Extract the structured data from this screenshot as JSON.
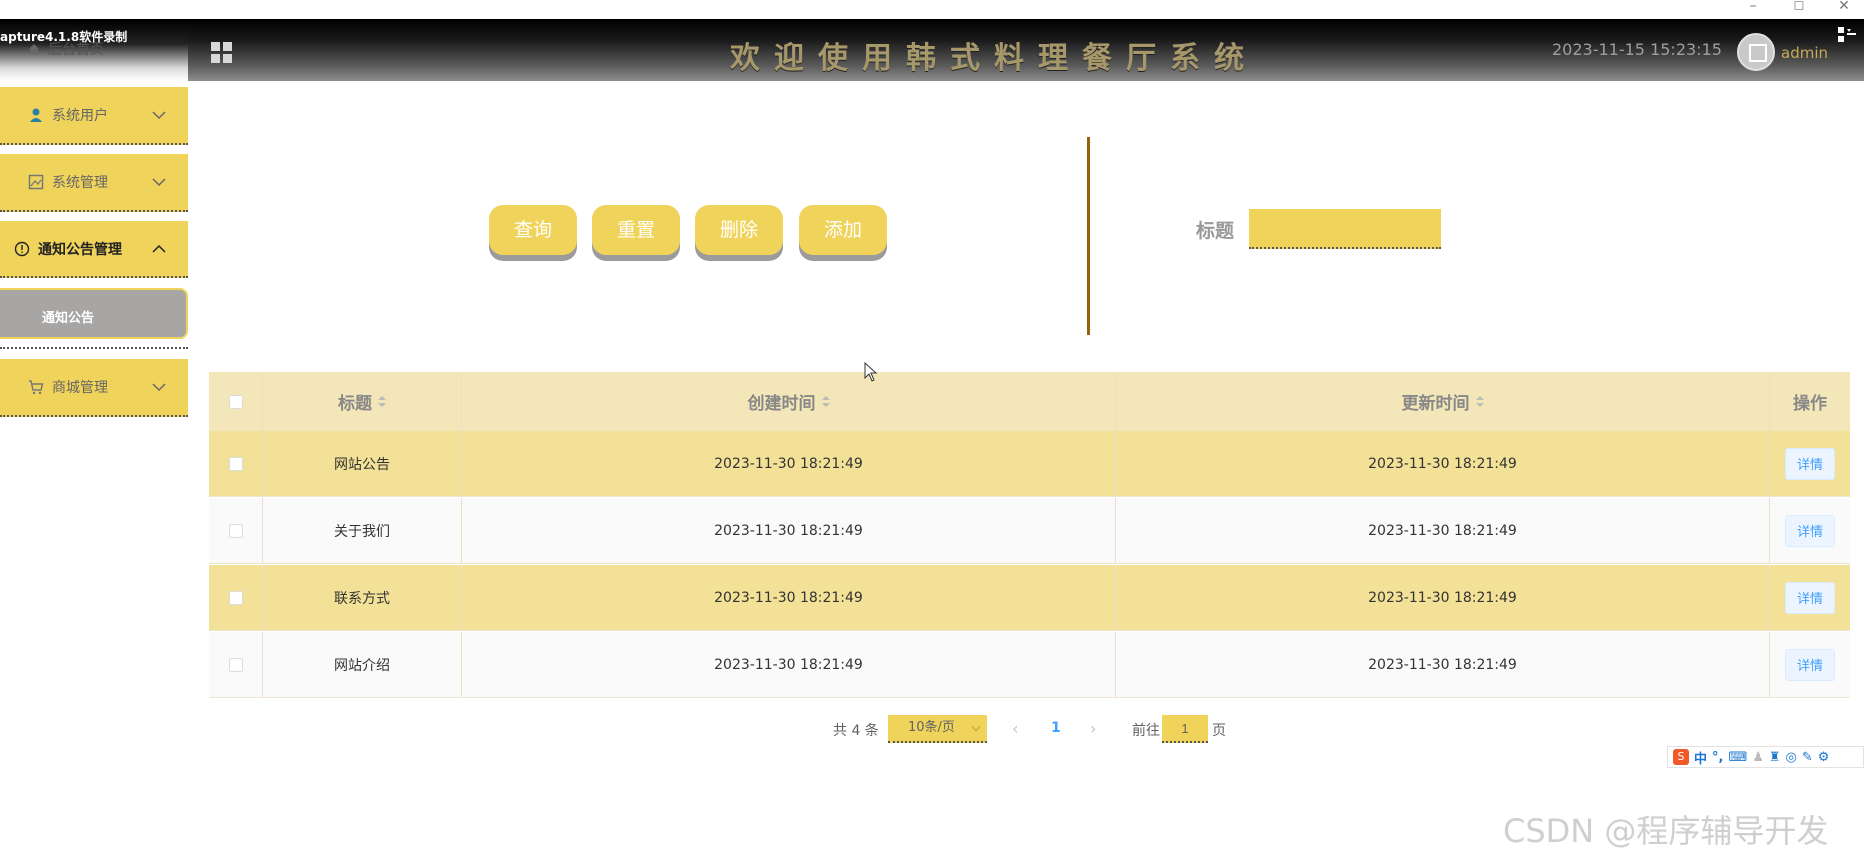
{
  "window": {
    "minimize": "–",
    "maximize": "☐",
    "close": "✕"
  },
  "header": {
    "recorder_label": "apture4.1.8软件录制",
    "home_label": "后台首页",
    "title": "欢迎使用韩式料理餐厅系统",
    "datetime": "2023-11-15 15:23:15",
    "username": "admin"
  },
  "sidebar": {
    "items": [
      {
        "label": "系统用户",
        "icon": "user-icon"
      },
      {
        "label": "系统管理",
        "icon": "image-icon"
      },
      {
        "label": "通知公告管理",
        "icon": "info-circle-icon",
        "expanded": true
      },
      {
        "label": "商城管理",
        "icon": "cart-icon"
      }
    ],
    "submenu": {
      "label": "通知公告"
    }
  },
  "toolbar": {
    "query_label": "查询",
    "reset_label": "重置",
    "delete_label": "删除",
    "add_label": "添加",
    "search_label": "标题",
    "search_value": ""
  },
  "table": {
    "columns": {
      "title": "标题",
      "created": "创建时间",
      "updated": "更新时间",
      "op": "操作"
    },
    "rows": [
      {
        "title": "网站公告",
        "created": "2023-11-30 18:21:49",
        "updated": "2023-11-30 18:21:49",
        "action": "详情"
      },
      {
        "title": "关于我们",
        "created": "2023-11-30 18:21:49",
        "updated": "2023-11-30 18:21:49",
        "action": "详情"
      },
      {
        "title": "联系方式",
        "created": "2023-11-30 18:21:49",
        "updated": "2023-11-30 18:21:49",
        "action": "详情"
      },
      {
        "title": "网站介绍",
        "created": "2023-11-30 18:21:49",
        "updated": "2023-11-30 18:21:49",
        "action": "详情"
      }
    ]
  },
  "pagination": {
    "total": "共 4 条",
    "page_size": "10条/页",
    "current_page": "1",
    "goto_label": "前往",
    "goto_value": "1",
    "page_suffix": "页"
  },
  "ime": {
    "brand": "S",
    "mode": "中",
    "punct": "°,"
  },
  "watermark": "CSDN @程序辅导开发",
  "colors": {
    "accent": "#f0d35a",
    "divider": "#96620c",
    "link": "#409eff"
  }
}
